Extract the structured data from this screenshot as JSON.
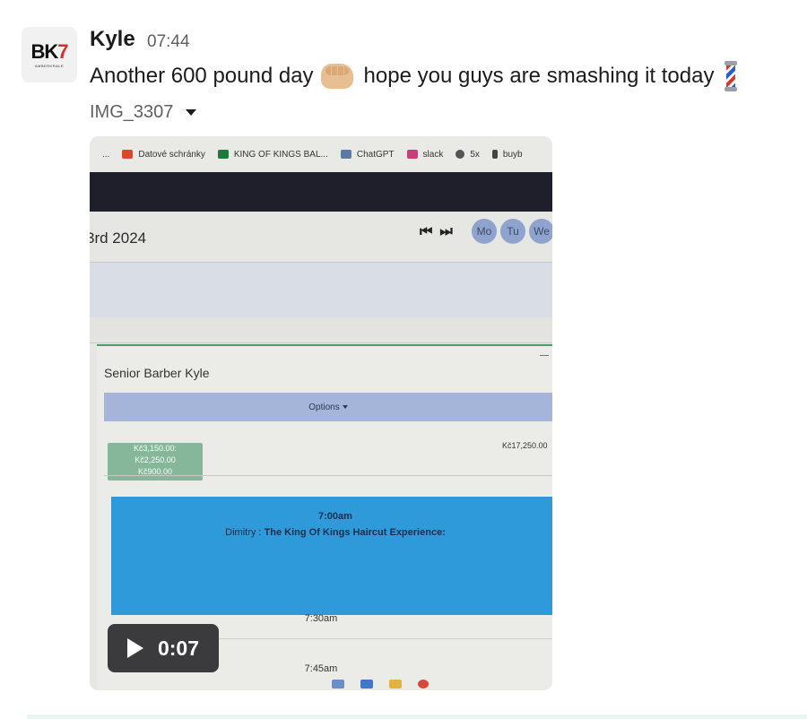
{
  "message": {
    "sender": "Kyle",
    "time": "07:44",
    "text_part1": "Another 600 pound day",
    "text_part2": "hope you guys are smashing it today",
    "emoji_1": "fist-bump-emoji",
    "emoji_2": "barber-pole-emoji",
    "attachment_name": "IMG_3307"
  },
  "avatar": {
    "logo_main": "BK",
    "logo_accent": "7",
    "logo_sub": "AMBERKRALE"
  },
  "video": {
    "duration": "0:07",
    "bookmarks": [
      "...",
      "Datové schránky",
      "KING OF KINGS BAL...",
      "ChatGPT",
      "slack",
      "5x",
      "buyb"
    ],
    "date_partial": "3rd 2024",
    "days": [
      "Mo",
      "Tu",
      "We"
    ],
    "barber": "Senior Barber Kyle",
    "options": "Options",
    "money_lines": [
      "Kč3,150.00:",
      "Kč2,250.00",
      "Kč900.00"
    ],
    "total": "Kč17,250.00",
    "appt_time": "7:00am",
    "appt_client": "Dimitry :",
    "appt_service": "The King Of Kings Haircut Experience:",
    "slots": [
      "7:30am",
      "7:45am"
    ]
  },
  "colors": {
    "accent_blue": "#2e9ad9",
    "money_green": "#87b79a",
    "avatar_red": "#d0302e"
  }
}
